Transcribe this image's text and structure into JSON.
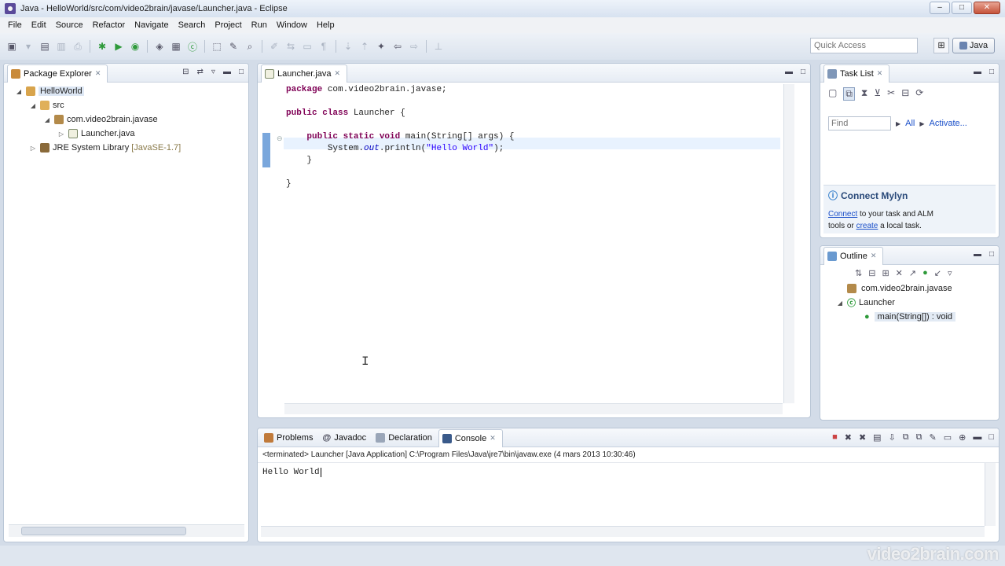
{
  "window": {
    "title": "Java - HelloWorld/src/com/video2brain/javase/Launcher.java - Eclipse",
    "min": "–",
    "max": "□",
    "close": "✕"
  },
  "menu": [
    "File",
    "Edit",
    "Source",
    "Refactor",
    "Navigate",
    "Search",
    "Project",
    "Run",
    "Window",
    "Help"
  ],
  "toolbar": {
    "quick_access_placeholder": "Quick Access",
    "perspective_label": "Java"
  },
  "package_explorer": {
    "tab_label": "Package Explorer",
    "tree": [
      {
        "label": "HelloWorld",
        "level": 0,
        "twisty": "◢"
      },
      {
        "label": "src",
        "level": 1,
        "twisty": "◢"
      },
      {
        "label": "com.video2brain.javase",
        "level": 2,
        "twisty": "◢"
      },
      {
        "label": "Launcher.java",
        "level": 3,
        "twisty": "▷"
      },
      {
        "label": "JRE System Library",
        "suffix": "[JavaSE-1.7]",
        "level": 1,
        "twisty": "▷"
      }
    ]
  },
  "editor": {
    "tab_label": "Launcher.java",
    "lines": [
      {
        "kw": "package",
        "rest": " com.video2brain.javase;"
      },
      {
        "blank": true
      },
      {
        "kw": "public class",
        "rest": " Launcher {"
      },
      {
        "blank": true
      },
      {
        "indent": "    ",
        "kw": "public static void",
        "rest": " main(String[] args) {"
      },
      {
        "indent": "        ",
        "pre": "System.",
        "field": "out",
        "mid": ".println(",
        "str": "\"Hello World\"",
        "post": ");"
      },
      {
        "indent": "    ",
        "rest": "}"
      },
      {
        "blank": true
      },
      {
        "rest": "}"
      }
    ]
  },
  "task_list": {
    "tab_label": "Task List",
    "find_placeholder": "Find",
    "all_label": "All",
    "activate_label": "Activate..."
  },
  "mylyn": {
    "title": "Connect Mylyn",
    "connect_link": "Connect",
    "text1": " to your task and ALM",
    "text2": "tools or ",
    "create_link": "create",
    "text3": " a local task."
  },
  "outline": {
    "tab_label": "Outline",
    "items": [
      {
        "label": "com.video2brain.javase"
      },
      {
        "label": "Launcher"
      },
      {
        "label": "main(String[]) : void"
      }
    ]
  },
  "console": {
    "tabs": [
      "Problems",
      "Javadoc",
      "Declaration",
      "Console"
    ],
    "header": "<terminated> Launcher [Java Application] C:\\Program Files\\Java\\jre7\\bin\\javaw.exe (4 mars 2013 10:30:46)",
    "output": "Hello World"
  },
  "watermark": "video2brain.com",
  "colors": {
    "keyword": "#7f0055",
    "string": "#2a00ff",
    "field": "#0000c0",
    "current_line": "#e8f2fe",
    "panel_border": "#b9c6d6"
  }
}
